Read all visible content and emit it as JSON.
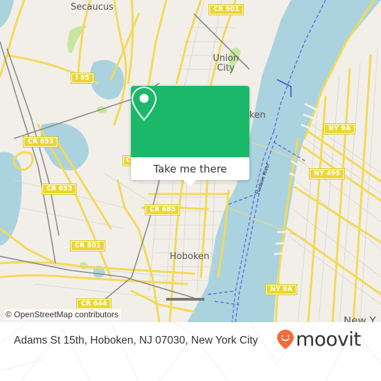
{
  "map": {
    "place_labels": [
      {
        "id": "secaucus",
        "text": "Secaucus"
      },
      {
        "id": "union-city",
        "text": "Union City"
      },
      {
        "id": "hoboken-north",
        "text": "ken"
      },
      {
        "id": "hoboken",
        "text": "Hoboken"
      },
      {
        "id": "new-york",
        "text": "New Y"
      }
    ],
    "road_shields": [
      {
        "id": "cr-501-top",
        "text": "CR 501"
      },
      {
        "id": "i-95",
        "text": "I 95"
      },
      {
        "id": "cr-653-upper",
        "text": "CR 653"
      },
      {
        "id": "cr-653-lower",
        "text": "CR 653"
      },
      {
        "id": "cr-685",
        "text": "CR 685"
      },
      {
        "id": "cr-501-lower",
        "text": "CR 501"
      },
      {
        "id": "cr-644",
        "text": "CR 644"
      },
      {
        "id": "ny-9a-upper",
        "text": "NY 9A"
      },
      {
        "id": "ny-495",
        "text": "NY 495"
      },
      {
        "id": "ny-9a-lower",
        "text": "NY 9A"
      },
      {
        "id": "cr-partial",
        "text": "C"
      }
    ],
    "river_label": "Hudson River",
    "colors": {
      "land": "#f2efe9",
      "water": "#aad3df",
      "park": "#c8e6a0",
      "major_road": "#f7e16a",
      "ferry": "#5b6ee1",
      "rail": "#888888"
    },
    "attribution": "© OpenStreetMap contributors"
  },
  "popup": {
    "icon": "map-pin-icon",
    "button_label": "Take me there",
    "accent": "#1cb86a"
  },
  "footer": {
    "address": "Adams St 15th, Hoboken, NJ 07030, New York City",
    "brand": "moovit",
    "brand_color": "#f26a3a"
  }
}
